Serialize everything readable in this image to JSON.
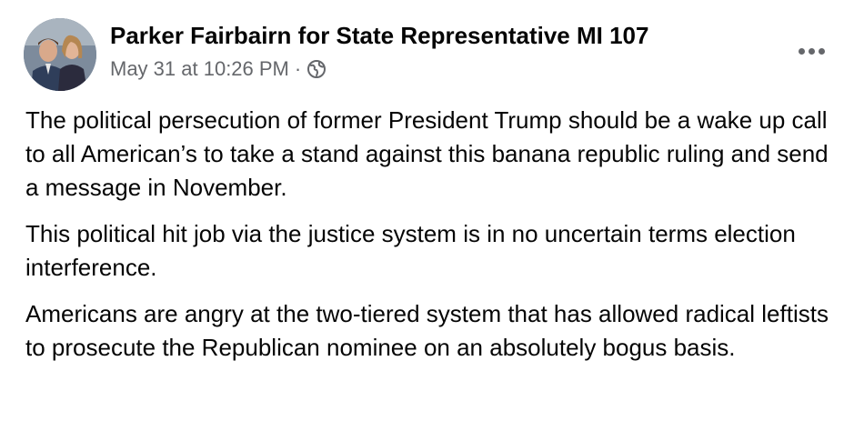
{
  "post": {
    "author": "Parker Fairbairn for State Representative MI 107",
    "timestamp": "May 31 at 10:26 PM",
    "separator": "·",
    "audience_icon": "globe-icon",
    "more_icon": "more-options-icon",
    "avatar_icon": "profile-photo",
    "paragraphs": [
      "The political persecution of former President Trump should be a wake up call to all American’s to take a stand against this banana republic ruling and send a message in November.",
      "This political hit job via the justice system is in no uncertain terms election interference.",
      "Americans are angry at the two-tiered system that has allowed radical leftists to prosecute the Republican nominee on an absolutely bogus basis."
    ]
  },
  "colors": {
    "text_primary": "#050505",
    "text_secondary": "#65676b"
  }
}
